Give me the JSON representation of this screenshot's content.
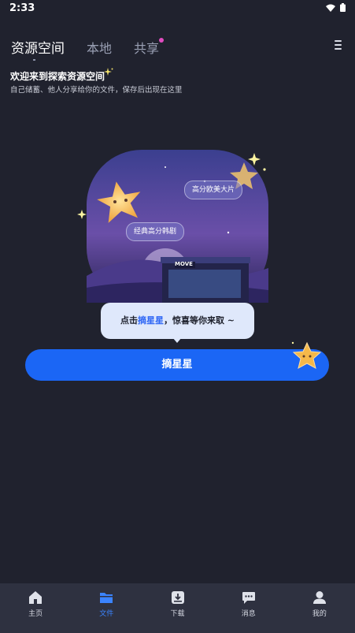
{
  "status": {
    "time": "2:33"
  },
  "tabs": {
    "items": [
      {
        "label": "资源空间"
      },
      {
        "label": "本地"
      },
      {
        "label": "共享"
      }
    ]
  },
  "welcome": {
    "title": "欢迎来到探索资源空间",
    "subtitle": "自己储蓄、他人分享给你的文件，保存后出现在这里"
  },
  "illustration": {
    "pill_top": "高分欧美大片",
    "pill_left": "经典高分韩剧",
    "shop_sign": "MOVE"
  },
  "tooltip": {
    "prefix": "点击",
    "highlight": "摘星星",
    "suffix": "，惊喜等你来取 ~"
  },
  "action_button": {
    "label": "摘星星"
  },
  "bottom_nav": {
    "items": [
      {
        "label": "主页",
        "icon": "home-icon"
      },
      {
        "label": "文件",
        "icon": "folder-icon"
      },
      {
        "label": "下载",
        "icon": "download-icon"
      },
      {
        "label": "消息",
        "icon": "message-icon"
      },
      {
        "label": "我的",
        "icon": "profile-icon"
      }
    ]
  },
  "colors": {
    "background": "#20222e",
    "accent": "#1b66f5",
    "active_nav": "#3b84ff",
    "tab_dot": "#e14cc0",
    "nav_bar": "#2e3140"
  }
}
